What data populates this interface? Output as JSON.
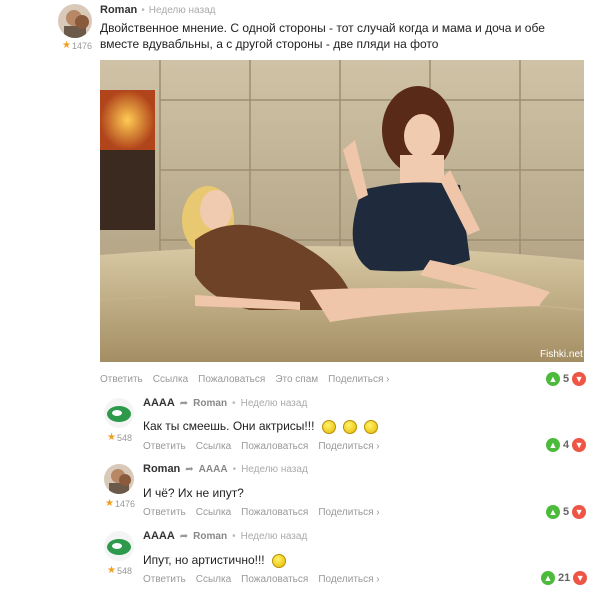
{
  "colors": {
    "upvote": "#4cbb3b",
    "downvote": "#ee5545",
    "star": "#f0a020"
  },
  "post": {
    "author": "Roman",
    "time": "Неделю назад",
    "rating": "1476",
    "text": "Двойственное мнение. С одной стороны - тот случай когда и мама и доча и обе вместе вдувабльны, а с другой стороны - две пляди на фото",
    "image_watermark": "Fishki.net",
    "actions": {
      "reply": "Ответить",
      "link": "Ссылка",
      "report": "Пожаловаться",
      "spam": "Это спам",
      "share": "Поделиться ›"
    },
    "votes": "5"
  },
  "comments": [
    {
      "author": "AAAA",
      "reply_to": "Roman",
      "time": "Неделю назад",
      "rating": "548",
      "text": "Как ты смеешь. Они актрисы!!!",
      "smileys": 3,
      "actions": {
        "reply": "Ответить",
        "link": "Ссылка",
        "report": "Пожаловаться",
        "share": "Поделиться ›"
      },
      "votes": "4"
    },
    {
      "author": "Roman",
      "reply_to": "AAAA",
      "time": "Неделю назад",
      "rating": "1476",
      "text": "И чё? Их не ипут?",
      "smileys": 0,
      "actions": {
        "reply": "Ответить",
        "link": "Ссылка",
        "report": "Пожаловаться",
        "share": "Поделиться ›"
      },
      "votes": "5"
    },
    {
      "author": "AAAA",
      "reply_to": "Roman",
      "time": "Неделю назад",
      "rating": "548",
      "text": "Ипут, но артистично!!!",
      "smileys": 1,
      "actions": {
        "reply": "Ответить",
        "link": "Ссылка",
        "report": "Пожаловаться",
        "share": "Поделиться ›"
      },
      "votes": "21"
    }
  ],
  "icons": {
    "star": "star-icon",
    "up": "thumb-up-icon",
    "down": "thumb-down-icon",
    "reply": "reply-arrow-icon",
    "smiley": "smiley-icon"
  }
}
